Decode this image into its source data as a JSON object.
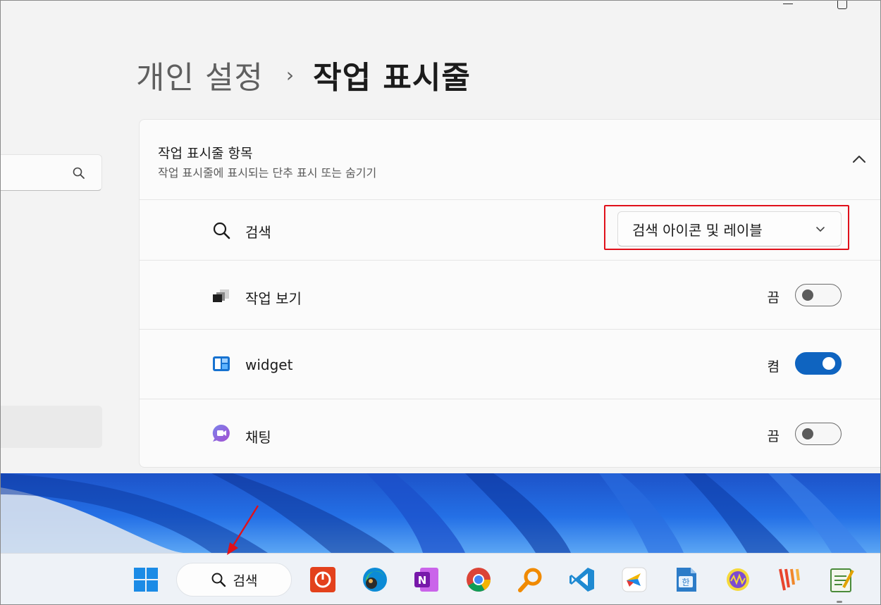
{
  "window": {
    "minimize_label": "",
    "maximize_label": ""
  },
  "breadcrumb": {
    "parent": "개인 설정",
    "separator": "›",
    "current": "작업 표시줄"
  },
  "section": {
    "title": "작업 표시줄 항목",
    "subtitle": "작업 표시줄에 표시되는 단추 표시 또는 숨기기",
    "collapse_icon": "chevron-up-icon",
    "items": [
      {
        "icon": "search-icon",
        "label": "검색",
        "control": "dropdown",
        "value": "검색 아이콘 및 레이블"
      },
      {
        "icon": "task-view-icon",
        "label": "작업 보기",
        "control": "toggle",
        "state_label": "끔",
        "on": false
      },
      {
        "icon": "widgets-icon",
        "label": "widget",
        "control": "toggle",
        "state_label": "켬",
        "on": true
      },
      {
        "icon": "chat-icon",
        "label": "채팅",
        "control": "toggle",
        "state_label": "끔",
        "on": false
      }
    ]
  },
  "taskbar": {
    "search_label": "검색",
    "apps": [
      "windows-start-icon",
      "power-app-icon",
      "edge-icon",
      "onenote-icon",
      "chrome-icon",
      "magnifier-search-app-icon",
      "vscode-icon",
      "messenger-app-icon",
      "hwp-icon",
      "audio-app-icon",
      "stripes-app-icon",
      "notepad-app-icon"
    ]
  },
  "colors": {
    "accent": "#0f64c0",
    "highlight": "#e0101a",
    "background": "#f3f3f3"
  }
}
